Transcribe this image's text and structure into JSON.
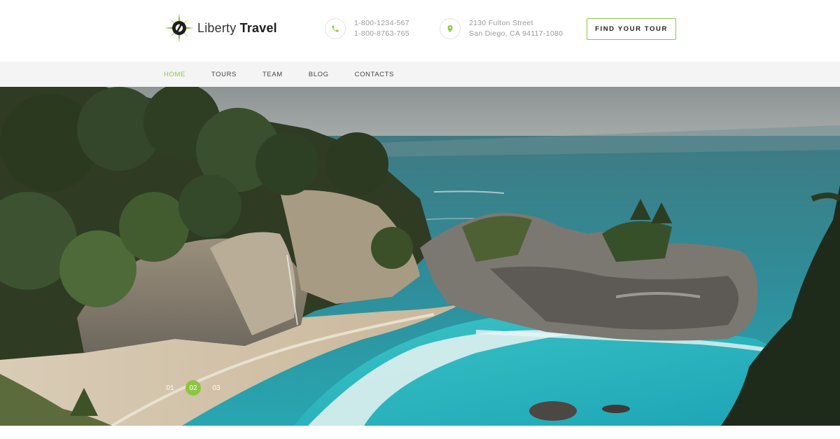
{
  "brand": {
    "name_light": "Liberty",
    "name_bold": "Travel",
    "logo_icon": "compass-logo-icon",
    "accent_color": "#8cc63f"
  },
  "header": {
    "phone": {
      "icon": "phone-icon",
      "line1": "1-800-1234-567",
      "line2": "1-800-8763-765"
    },
    "address": {
      "icon": "map-pin-icon",
      "line1": "2130 Fulton Street",
      "line2": "San Diego, CA 94117-1080"
    },
    "cta_label": "FIND YOUR TOUR"
  },
  "nav": {
    "items": [
      {
        "label": "HOME",
        "active": true
      },
      {
        "label": "TOURS",
        "active": false
      },
      {
        "label": "TEAM",
        "active": false
      },
      {
        "label": "BLOG",
        "active": false
      },
      {
        "label": "CONTACTS",
        "active": false
      }
    ]
  },
  "slider": {
    "pages": [
      "01",
      "02",
      "03"
    ],
    "active_page": "02"
  }
}
